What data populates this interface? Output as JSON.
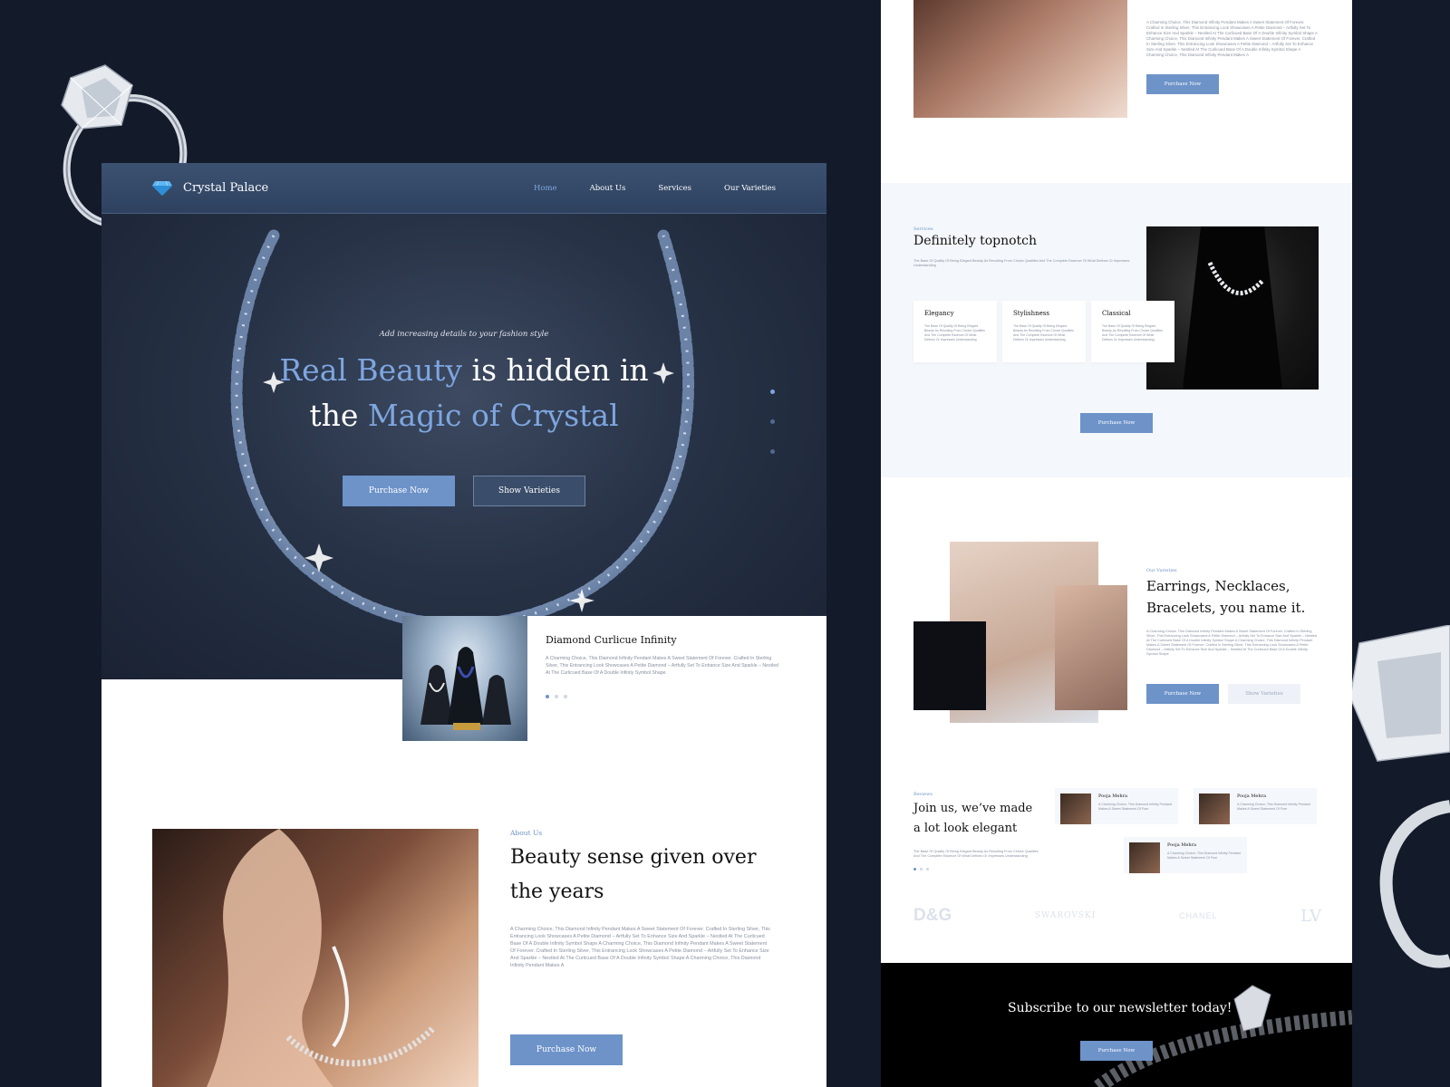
{
  "colors": {
    "accent": "#6d93c9",
    "dark_bg": "#131a29",
    "hero": "#273246"
  },
  "icons": {
    "logo": "diamond-icon"
  },
  "left": {
    "brand": "Crystal Palace",
    "nav": [
      "Home",
      "About Us",
      "Services",
      "Our Varieties"
    ],
    "tagline": "Add increasing details to your fashion style",
    "headline": {
      "p1": "Real Beauty",
      "p2": " is hidden in",
      "p3": "the ",
      "p4": "Magic of Crystal"
    },
    "btn_primary": "Purchase Now",
    "btn_secondary": "Show Varieties",
    "card": {
      "title": "Diamond Curlicue Infinity",
      "desc": "A Charming Choice, This Diamond Infinity Pendant Makes A Sweet Statement Of Forever. Crafted In Sterling Silver, This Entrancing Look Showcases A Petite Diamond – Artfully Set To Enhance Size And Sparkle – Nestled At The Curlicued Base Of A Double Infinity Symbol Shape."
    },
    "about": {
      "eyebrow": "About Us",
      "title": "Beauty sense given over the years",
      "para": "A Charming Choice, This Diamond Infinity Pendant Makes A Sweet Statement Of Forever. Crafted In Sterling Silver, This Entrancing Look Showcases A Petite Diamond – Artfully Set To Enhance Size And Sparkle – Nestled At The Curlicued Base Of A Double Infinity Symbol Shape A Charming Choice, This Diamond Infinity Pendant Makes A Sweet Statement Of Forever. Crafted In Sterling Silver, This Entrancing Look Showcases A Petite Diamond – Artfully Set To Enhance Size And Sparkle – Nestled At The Curlicued Base Of A Double Infinity Symbol Shape A Charming Choice, This Diamond Infinity Pendant Makes A",
      "btn": "Purchase Now"
    }
  },
  "right": {
    "sec1": {
      "para": "A Charming Choice, This Diamond Infinity Pendant Makes A Sweet Statement Of Forever. Crafted In Sterling Silver, This Entrancing Look Showcases A Petite Diamond – Artfully Set To Enhance Size And Sparkle – Nestled At The Curlicued Base Of A Double Infinity Symbol Shape A Charming Choice, This Diamond Infinity Pendant Makes A Sweet Statement Of Forever. Crafted In Sterling Silver, This Entrancing Look Showcases A Petite Diamond – Artfully Set To Enhance Size And Sparkle – Nestled At The Curlicued Base Of A Double Infinity Symbol Shape A Charming Choice, This Diamond Infinity Pendant Makes A",
      "btn": "Purchase Now"
    },
    "services": {
      "eyebrow": "Services",
      "title": "Definitely topnotch",
      "desc": "The Base Of Quality Of Being Elegant Beauty As Resulting From Choice Qualities And The Complete Essence Of What Defines Or Impresses Understanding",
      "features": [
        {
          "title": "Elegancy",
          "desc": "The Base Of Quality Of Being Elegant Beauty As Resulting From Choice Qualities And The Complete Essence Of What Defines Or Impresses Understanding"
        },
        {
          "title": "Stylishness",
          "desc": "The Base Of Quality Of Being Elegant Beauty As Resulting From Choice Qualities And The Complete Essence Of What Defines Or Impresses Understanding"
        },
        {
          "title": "Classical",
          "desc": "The Base Of Quality Of Being Elegant Beauty As Resulting From Choice Qualities And The Complete Essence Of What Defines Or Impresses Understanding"
        }
      ],
      "btn": "Purchase Now"
    },
    "varieties": {
      "eyebrow": "Our Varieties",
      "title": "Earrings, Necklaces, Bracelets, you name it.",
      "para": "A Charming Choice, This Diamond Infinity Pendant Makes A Sweet Statement Of Forever. Crafted In Sterling Silver, This Entrancing Look Showcases A Petite Diamond – Artfully Set To Enhance Size And Sparkle – Nestled At The Curlicued Base Of A Double Infinity Symbol Shape A Charming Choice, This Diamond Infinity Pendant Makes A Sweet Statement Of Forever. Crafted In Sterling Silver, This Entrancing Look Showcases A Petite Diamond – Artfully Set To Enhance Size And Sparkle – Nestled At The Curlicued Base Of A Double Infinity Symbol Shape",
      "btn_primary": "Purchase Now",
      "btn_secondary": "Show Varieties"
    },
    "reviews": {
      "eyebrow": "Reviews",
      "title": "Join us, we’ve made a lot look elegant",
      "desc": "The Base Of Quality Of Being Elegant Beauty As Resulting From Choice Qualities And The Complete Essence Of What Defines Or Impresses Understanding",
      "items": [
        {
          "name": "Pooja Mehra",
          "text": "A Charming Choice, This Diamond Infinity Pendant Makes A Sweet Statement Of Fore"
        },
        {
          "name": "Pooja Mehra",
          "text": "A Charming Choice, This Diamond Infinity Pendant Makes A Sweet Statement Of Fore"
        },
        {
          "name": "Pooja Mehra",
          "text": "A Charming Choice, This Diamond Infinity Pendant Makes A Sweet Statement Of Fore"
        }
      ]
    },
    "brands": [
      "D&G",
      "SWAROVSKI",
      "CHANEL",
      "LV"
    ],
    "newsletter": {
      "title": "Subscribe to our newsletter today!",
      "btn": "Purchase Now"
    }
  }
}
